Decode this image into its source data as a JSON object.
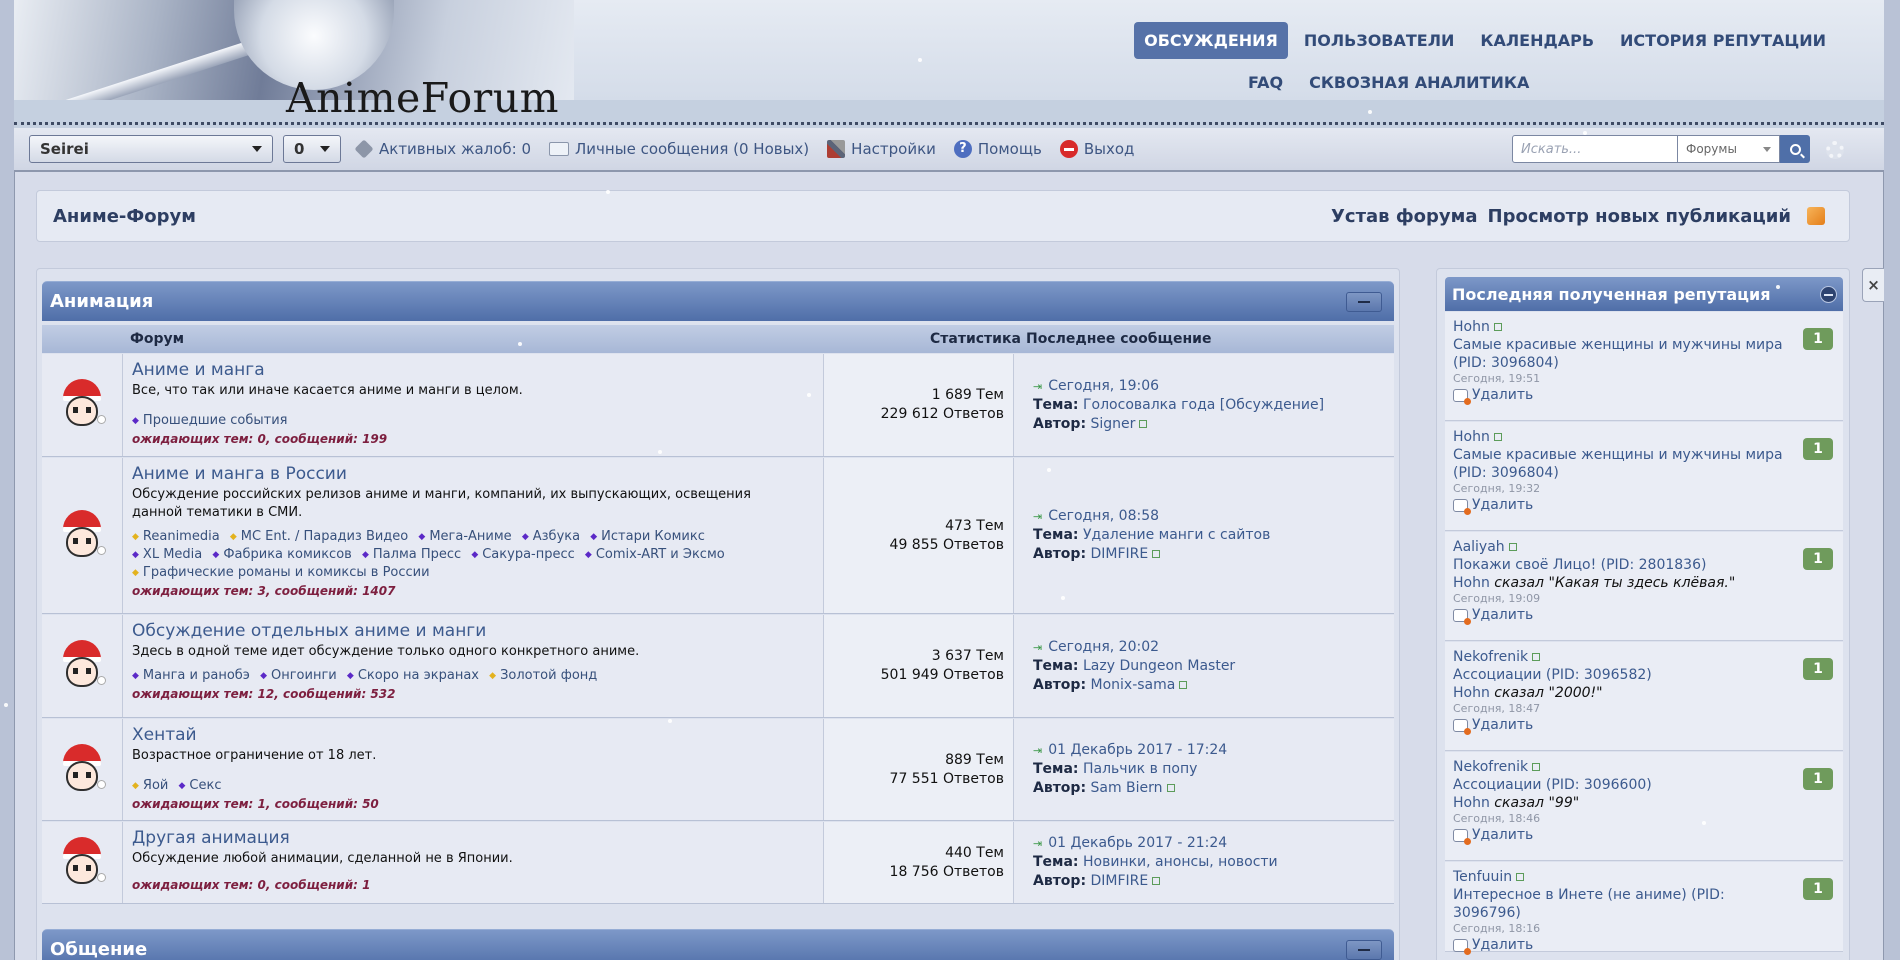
{
  "site": {
    "logo": "AnimeForum"
  },
  "nav": {
    "primary": [
      "ОБСУЖДЕНИЯ",
      "ПОЛЬЗОВАТЕЛИ",
      "КАЛЕНДАРЬ",
      "ИСТОРИЯ РЕПУТАЦИИ"
    ],
    "secondary": [
      "FAQ",
      "СКВОЗНАЯ АНАЛИТИКА"
    ],
    "active": "ОБСУЖДЕНИЯ"
  },
  "toolbar": {
    "user_select": "Seirei",
    "count_select": "0",
    "complaints": "Активных жалоб: 0",
    "messages": "Личные сообщения (0 Новых)",
    "settings": "Настройки",
    "help": "Помощь",
    "logout": "Выход"
  },
  "search": {
    "placeholder": "Искать...",
    "scope": "Форумы"
  },
  "breadcrumb": {
    "title": "Аниме-Форум",
    "rules": "Устав форума",
    "new_posts": "Просмотр новых публикаций"
  },
  "categories": [
    {
      "title": "Анимация"
    },
    {
      "title": "Общение"
    }
  ],
  "columns": {
    "forum": "Форум",
    "stats": "Статистика",
    "last": "Последнее сообщение"
  },
  "labels": {
    "topic": "Тема:",
    "author": "Автор:"
  },
  "forums": [
    {
      "title": "Аниме и манга",
      "desc": "Все, что так или иначе касается аниме и манги в целом.",
      "subs": [
        {
          "name": "Прошедшие события",
          "gold": false
        }
      ],
      "pending": "ожидающих тем: 0, сообщений: 199",
      "topics": "1 689 Тем",
      "replies": "229 612 Ответов",
      "last_date": "Сегодня, 19:06",
      "last_topic": "Голосовалка года [Обсуждение]",
      "last_author": "Signer"
    },
    {
      "title": "Аниме и манга в России",
      "desc": "Обсуждение российских релизов аниме и манги, компаний, их выпускающих, освещения данной тематики в СМИ.",
      "subs": [
        {
          "name": "Reanimedia",
          "gold": true
        },
        {
          "name": "MC Ent. / Парадиз Видео",
          "gold": true
        },
        {
          "name": "Мега-Аниме",
          "gold": false
        },
        {
          "name": "Азбука",
          "gold": false
        },
        {
          "name": "Истари Комикс",
          "gold": false
        },
        {
          "name": "XL Media",
          "gold": false
        },
        {
          "name": "Фабрика комиксов",
          "gold": false
        },
        {
          "name": "Палма Пресс",
          "gold": false
        },
        {
          "name": "Сакура-пресс",
          "gold": false
        },
        {
          "name": "Comix-ART и Эксмо",
          "gold": false
        },
        {
          "name": "Графические романы и комиксы в России",
          "gold": true
        }
      ],
      "pending": "ожидающих тем: 3, сообщений: 1407",
      "topics": "473 Тем",
      "replies": "49 855 Ответов",
      "last_date": "Сегодня, 08:58",
      "last_topic": "Удаление манги с сайтов",
      "last_author": "DIMFIRE"
    },
    {
      "title": "Обсуждение отдельных аниме и манги",
      "desc": "Здесь в одной теме идет обсуждение только одного конкретного аниме.",
      "subs": [
        {
          "name": "Манга и ранобэ",
          "gold": false
        },
        {
          "name": "Онгоинги",
          "gold": false
        },
        {
          "name": "Скоро на экранах",
          "gold": false
        },
        {
          "name": "Золотой фонд",
          "gold": true
        }
      ],
      "pending": "ожидающих тем: 12, сообщений: 532",
      "topics": "3 637 Тем",
      "replies": "501 949 Ответов",
      "last_date": "Сегодня, 20:02",
      "last_topic": "Lazy Dungeon Master",
      "last_author": "Monix-sama"
    },
    {
      "title": "Хентай",
      "desc": "Возрастное ограничение от 18 лет.",
      "subs": [
        {
          "name": "Яой",
          "gold": true
        },
        {
          "name": "Секс",
          "gold": false
        }
      ],
      "pending": "ожидающих тем: 1, сообщений: 50",
      "topics": "889 Тем",
      "replies": "77 551 Ответов",
      "last_date": "01 Декабрь 2017 - 17:24",
      "last_topic": "Пальчик в попу",
      "last_author": "Sam Biern"
    },
    {
      "title": "Другая анимация",
      "desc": "Обсуждение любой анимации, сделанной не в Японии.",
      "subs": [],
      "pending": "ожидающих тем: 0, сообщений: 1",
      "topics": "440 Тем",
      "replies": "18 756 Ответов",
      "last_date": "01 Декабрь 2017 - 21:24",
      "last_topic": "Новинки, анонсы, новости",
      "last_author": "DIMFIRE"
    }
  ],
  "sidebar": {
    "title": "Последняя полученная репутация",
    "delete_label": "Удалить",
    "items": [
      {
        "user": "Hohn",
        "topic": "Самые красивые женщины и мужчины мира (PID: 3096804)",
        "said_by": "",
        "quote": "",
        "time": "Сегодня, 19:51",
        "points": "1"
      },
      {
        "user": "Hohn",
        "topic": "Самые красивые женщины и мужчины мира (PID: 3096804)",
        "said_by": "",
        "quote": "",
        "time": "Сегодня, 19:32",
        "points": "1"
      },
      {
        "user": "Aaliyah",
        "topic": "Покажи своё Лицо! (PID: 2801836)",
        "said_by": "Hohn",
        "quote": "\"Какая ты здесь клёвая.\"",
        "time": "Сегодня, 19:09",
        "points": "1"
      },
      {
        "user": "Nekofrenik",
        "topic": "Ассоциации (PID: 3096582)",
        "said_by": "Hohn",
        "quote": "\"2000!\"",
        "time": "Сегодня, 18:47",
        "points": "1"
      },
      {
        "user": "Nekofrenik",
        "topic": "Ассоциации (PID: 3096600)",
        "said_by": "Hohn",
        "quote": "\"99\"",
        "time": "Сегодня, 18:46",
        "points": "1"
      },
      {
        "user": "Tenfuuin",
        "topic": "Интересное в Инете (не аниме) (PID: 3096796)",
        "said_by": "",
        "quote": "",
        "time": "Сегодня, 18:16",
        "points": "1"
      }
    ],
    "said_word": "сказал"
  }
}
